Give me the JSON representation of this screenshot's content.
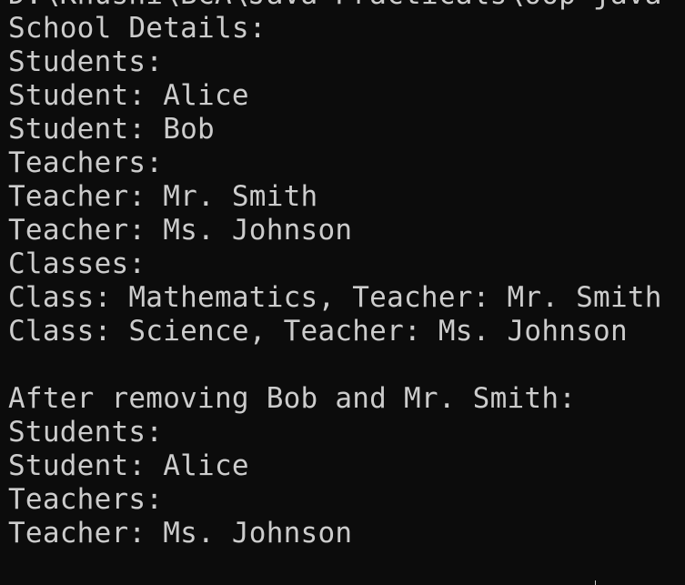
{
  "terminal": {
    "lines": [
      "D:\\Khushi\\BCA\\Java Practicals\\oop-java",
      "School Details:",
      "Students:",
      "Student: Alice",
      "Student: Bob",
      "Teachers:",
      "Teacher: Mr. Smith",
      "Teacher: Ms. Johnson",
      "Classes:",
      "Class: Mathematics, Teacher: Mr. Smith",
      "Class: Science, Teacher: Ms. Johnson",
      "",
      "After removing Bob and Mr. Smith:",
      "Students:",
      "Student: Alice",
      "Teachers:",
      "Teacher: Ms. Johnson"
    ],
    "colors": {
      "background": "#0c0c0c",
      "foreground": "#cccccc"
    }
  }
}
